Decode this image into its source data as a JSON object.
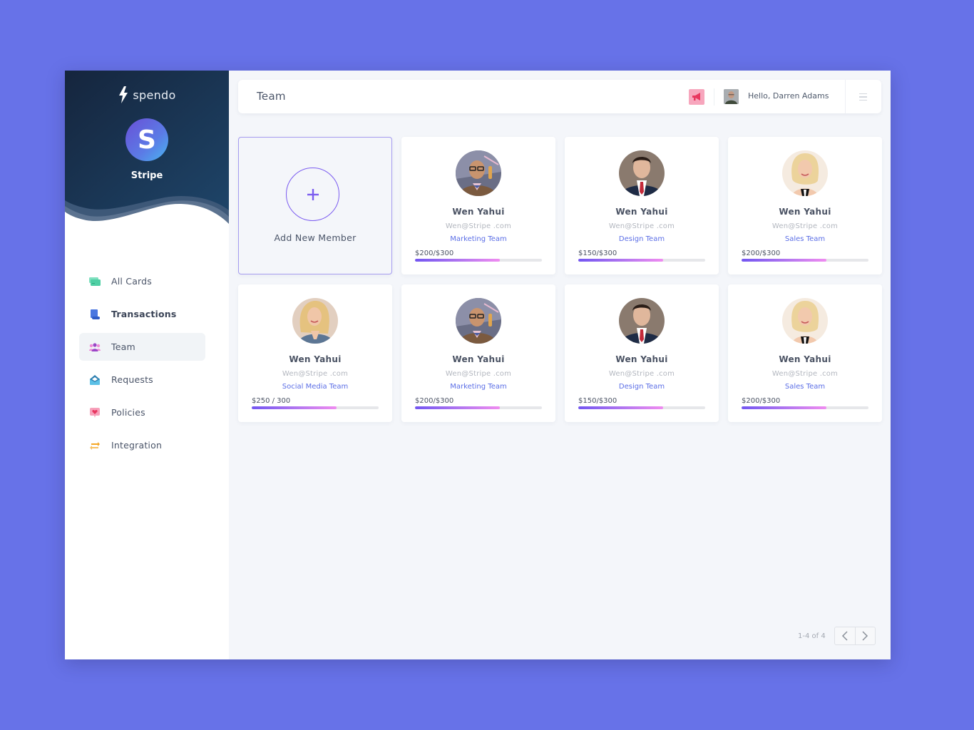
{
  "app": {
    "brand_name": "spendo",
    "org_name": "Stripe",
    "org_initial": "S"
  },
  "sidebar": {
    "items": [
      {
        "label": "All Cards",
        "icon": "cards-icon",
        "color": "#4fcfa4",
        "active": false
      },
      {
        "label": "Transactions",
        "icon": "scroll-icon",
        "color": "#4a77e0",
        "active": false
      },
      {
        "label": "Team",
        "icon": "team-icon",
        "color": "#c45dd8",
        "active": true
      },
      {
        "label": "Requests",
        "icon": "envelope-icon",
        "color": "#4aaed8",
        "active": false
      },
      {
        "label": "Policies",
        "icon": "heart-message-icon",
        "color": "#f26a8d",
        "active": false
      },
      {
        "label": "Integration",
        "icon": "swap-arrows-icon",
        "color": "#f5a623",
        "active": false
      }
    ]
  },
  "header": {
    "title": "Team",
    "greeting": "Hello, Darren Adams",
    "notification_icon": "megaphone-icon",
    "menu_icon": "hamburger-icon"
  },
  "add_card": {
    "label": "Add New Member",
    "icon": "plus-icon"
  },
  "members": [
    {
      "name": "Wen Yahui",
      "email": "Wen@Stripe .com",
      "team": "Marketing Team",
      "budget_label": "$200/$300",
      "spent": 200,
      "limit": 300,
      "avatar": "man-glasses-bowtie"
    },
    {
      "name": "Wen Yahui",
      "email": "Wen@Stripe .com",
      "team": "Design Team",
      "budget_label": "$150/$300",
      "spent": 150,
      "limit": 300,
      "avatar": "man-suit-red-tie"
    },
    {
      "name": "Wen Yahui",
      "email": "Wen@Stripe .com",
      "team": "Sales Team",
      "budget_label": "$200/$300",
      "spent": 200,
      "limit": 300,
      "avatar": "woman-blonde-light"
    },
    {
      "name": "Wen Yahui",
      "email": "Wen@Stripe .com",
      "team": "Social Media Team",
      "budget_label": "$250 / 300",
      "spent": 250,
      "limit": 300,
      "avatar": "woman-blonde-denim"
    },
    {
      "name": "Wen Yahui",
      "email": "Wen@Stripe .com",
      "team": "Marketing Team",
      "budget_label": "$200/$300",
      "spent": 200,
      "limit": 300,
      "avatar": "man-glasses-bowtie"
    },
    {
      "name": "Wen Yahui",
      "email": "Wen@Stripe .com",
      "team": "Design Team",
      "budget_label": "$150/$300",
      "spent": 150,
      "limit": 300,
      "avatar": "man-suit-red-tie"
    },
    {
      "name": "Wen Yahui",
      "email": "Wen@Stripe .com",
      "team": "Sales Team",
      "budget_label": "$200/$300",
      "spent": 200,
      "limit": 300,
      "avatar": "woman-blonde-light"
    }
  ],
  "progress_fill_displayed": 0.667,
  "pagination": {
    "label": "1-4 of 4",
    "prev_icon": "chevron-left-icon",
    "next_icon": "chevron-right-icon"
  },
  "colors": {
    "background": "#6772e8",
    "accent": "#7b5cf0",
    "team_link": "#5b6ee6",
    "sidebar_dark": "#1b3452"
  }
}
